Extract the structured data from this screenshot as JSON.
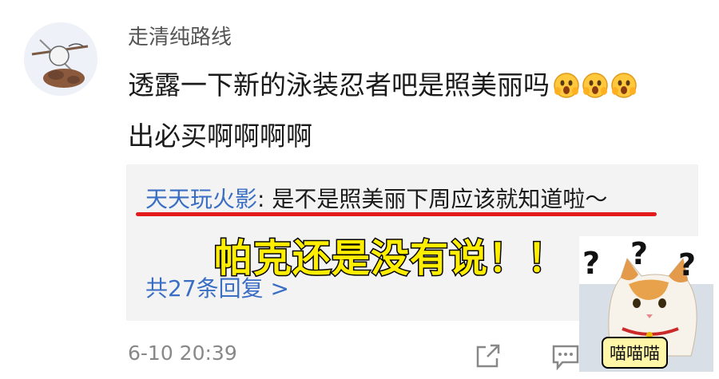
{
  "comment": {
    "username": "走清纯路线",
    "text": "透露一下新的泳装忍者吧是照美丽吗",
    "text_line2": "出必买啊啊啊啊",
    "emoji_icons": [
      "surprised-face-icon",
      "surprised-face-icon",
      "surprised-face-icon"
    ],
    "timestamp": "6-10 20:39"
  },
  "reply": {
    "author": "天天玩火影",
    "separator": ": ",
    "text": "是不是照美丽下周应该就知道啦～",
    "more_link": "共27条回复 >"
  },
  "overlay_caption": "帕克还是没有说！！",
  "meme": {
    "caption": "喵喵喵",
    "symbols": [
      "?",
      "?",
      "?"
    ]
  },
  "actions": {
    "share_icon": "share-icon",
    "reply_icon": "comment-icon"
  },
  "colors": {
    "link": "#3a6ec4",
    "underline": "#e31b1b",
    "overlay_text": "#ffee00",
    "reply_bg": "#f3f3f3"
  }
}
